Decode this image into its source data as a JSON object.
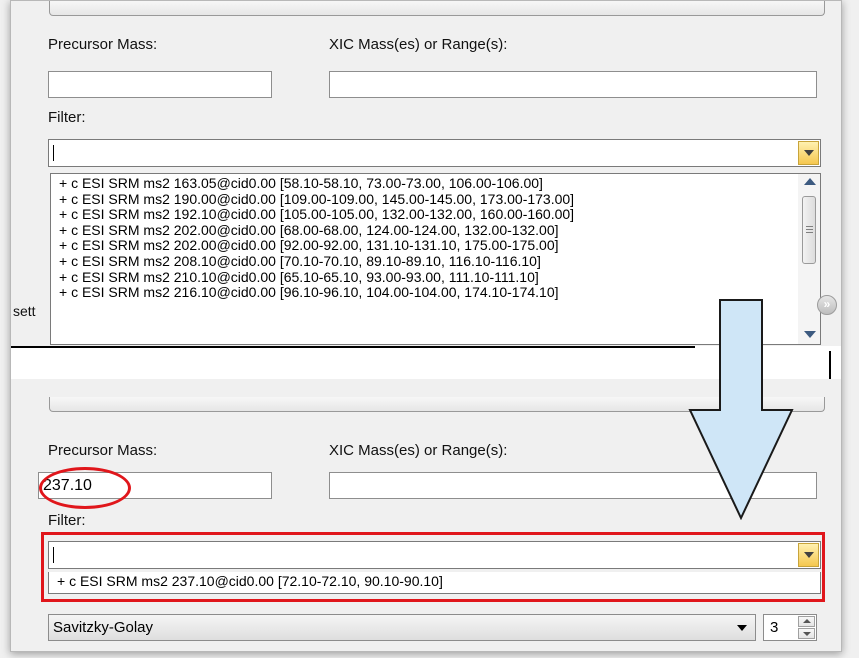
{
  "top_panel": {
    "precursor_label": "Precursor Mass:",
    "precursor_value": "",
    "xic_label": "XIC Mass(es) or Range(s):",
    "xic_value": "",
    "filter_label": "Filter:",
    "filter_items": [
      "+ c ESI SRM ms2 163.05@cid0.00 [58.10-58.10, 73.00-73.00, 106.00-106.00]",
      "+ c ESI SRM ms2 190.00@cid0.00 [109.00-109.00, 145.00-145.00, 173.00-173.00]",
      "+ c ESI SRM ms2 192.10@cid0.00 [105.00-105.00, 132.00-132.00, 160.00-160.00]",
      "+ c ESI SRM ms2 202.00@cid0.00 [68.00-68.00, 124.00-124.00, 132.00-132.00]",
      "+ c ESI SRM ms2 202.00@cid0.00 [92.00-92.00, 131.10-131.10, 175.00-175.00]",
      "+ c ESI SRM ms2 208.10@cid0.00 [70.10-70.10, 89.10-89.10, 116.10-116.10]",
      "+ c ESI SRM ms2 210.10@cid0.00 [65.10-65.10, 93.00-93.00, 111.10-111.10]",
      "+ c ESI SRM ms2 216.10@cid0.00 [96.10-96.10, 104.00-104.00, 174.10-174.10]"
    ],
    "side_label": "sett",
    "expand_icon": "double-chevron-down-icon"
  },
  "bottom_panel": {
    "precursor_label": "Precursor Mass:",
    "precursor_value": "237.10",
    "xic_label": "XIC Mass(es) or Range(s):",
    "xic_value": "",
    "filter_label": "Filter:",
    "filter_items": [
      "+ c ESI SRM ms2 237.10@cid0.00 [72.10-72.10, 90.10-90.10]"
    ],
    "smoothing_type": "Savitzky-Golay",
    "smoothing_points": "3"
  },
  "colors": {
    "highlight": "#e0161b",
    "arrow_fill": "#cfe6f7"
  }
}
